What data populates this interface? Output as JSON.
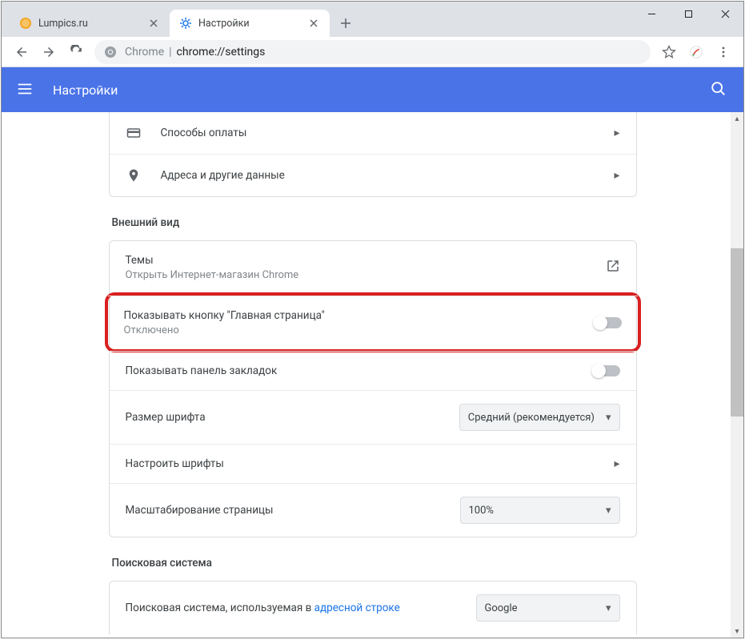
{
  "window": {
    "tabs": [
      {
        "title": "Lumpics.ru"
      },
      {
        "title": "Настройки"
      }
    ]
  },
  "addressbar": {
    "origin": "Chrome",
    "path": "chrome://settings"
  },
  "header": {
    "title": "Настройки"
  },
  "autofill": {
    "payment": "Способы оплаты",
    "addresses": "Адреса и другие данные"
  },
  "appearance": {
    "section": "Внешний вид",
    "themes": {
      "primary": "Темы",
      "secondary": "Открыть Интернет-магазин Chrome"
    },
    "home_button": {
      "primary": "Показывать кнопку \"Главная страница\"",
      "secondary": "Отключено"
    },
    "bookmarks_bar": "Показывать панель закладок",
    "font_size": {
      "label": "Размер шрифта",
      "value": "Средний (рекомендуется)"
    },
    "customize_fonts": "Настроить шрифты",
    "page_zoom": {
      "label": "Масштабирование страницы",
      "value": "100%"
    }
  },
  "search": {
    "section": "Поисковая система",
    "engine_label_a": "Поисковая система, используемая в ",
    "engine_label_b": "адресной строке",
    "engine_value": "Google"
  }
}
